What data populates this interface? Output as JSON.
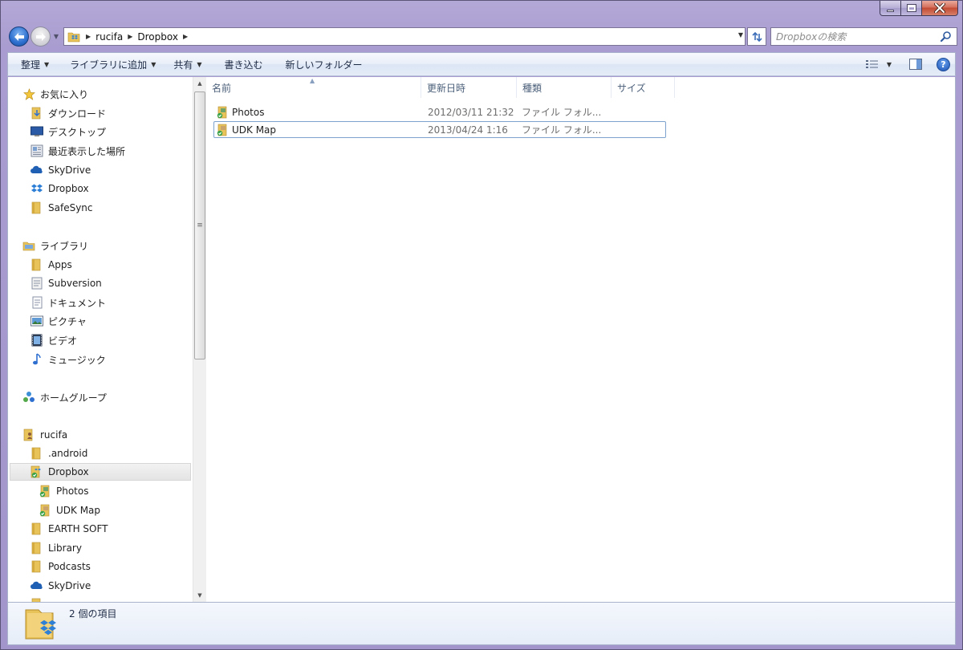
{
  "window": {
    "caption": {
      "minimize": "–",
      "maximize": "□",
      "close": "✕"
    }
  },
  "nav": {
    "breadcrumbs": [
      "rucifa",
      "Dropbox"
    ],
    "search_placeholder": "Dropboxの検索"
  },
  "commands": {
    "organize": "整理",
    "add_to_library": "ライブラリに追加",
    "share": "共有",
    "burn": "書き込む",
    "new_folder": "新しいフォルダー"
  },
  "nav_pane": {
    "favorites_header": "お気に入り",
    "favorites": [
      "ダウンロード",
      "デスクトップ",
      "最近表示した場所",
      "SkyDrive",
      "Dropbox",
      "SafeSync"
    ],
    "libraries_header": "ライブラリ",
    "libraries": [
      "Apps",
      "Subversion",
      "ドキュメント",
      "ピクチャ",
      "ビデオ",
      "ミュージック"
    ],
    "homegroup": "ホームグループ",
    "user_header": "rucifa",
    "user_folders": [
      ".android",
      "Dropbox",
      "Photos",
      "UDK Map",
      "EARTH SOFT",
      "Library",
      "Podcasts",
      "SkyDrive"
    ]
  },
  "columns": {
    "name": "名前",
    "date": "更新日時",
    "type": "種類",
    "size": "サイズ"
  },
  "files": [
    {
      "name": "Photos",
      "date": "2012/03/11 21:32",
      "type": "ファイル フォル..."
    },
    {
      "name": "UDK Map",
      "date": "2013/04/24 1:16",
      "type": "ファイル フォル..."
    }
  ],
  "status": {
    "item_count": "2 個の項目"
  },
  "colors": {
    "window_frame": "#a89cd0",
    "selection_border": "#7da2ce",
    "dropbox_blue": "#2e7fd6",
    "folder_yellow": "#e8c35a"
  }
}
